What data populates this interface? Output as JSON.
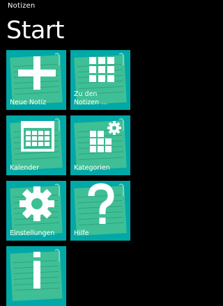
{
  "app": {
    "title": "Notizen",
    "page_title": "Start"
  },
  "colors": {
    "background": "#000000",
    "tile_accent": "#00a8a8",
    "tile_paper": "#3fbf96",
    "tile_text": "#ffffff"
  },
  "tiles": [
    {
      "label": "Neue Notiz",
      "icon": "plus-icon"
    },
    {
      "label": "Zu den\nNotizen ...",
      "icon": "grid-icon"
    },
    {
      "label": "Kalender",
      "icon": "calendar-icon"
    },
    {
      "label": "Kategorien",
      "icon": "categories-gear-icon"
    },
    {
      "label": "Einstellungen",
      "icon": "gear-icon"
    },
    {
      "label": "Hilfe",
      "icon": "question-mark-icon"
    },
    {
      "label": "",
      "icon": "info-icon"
    }
  ]
}
